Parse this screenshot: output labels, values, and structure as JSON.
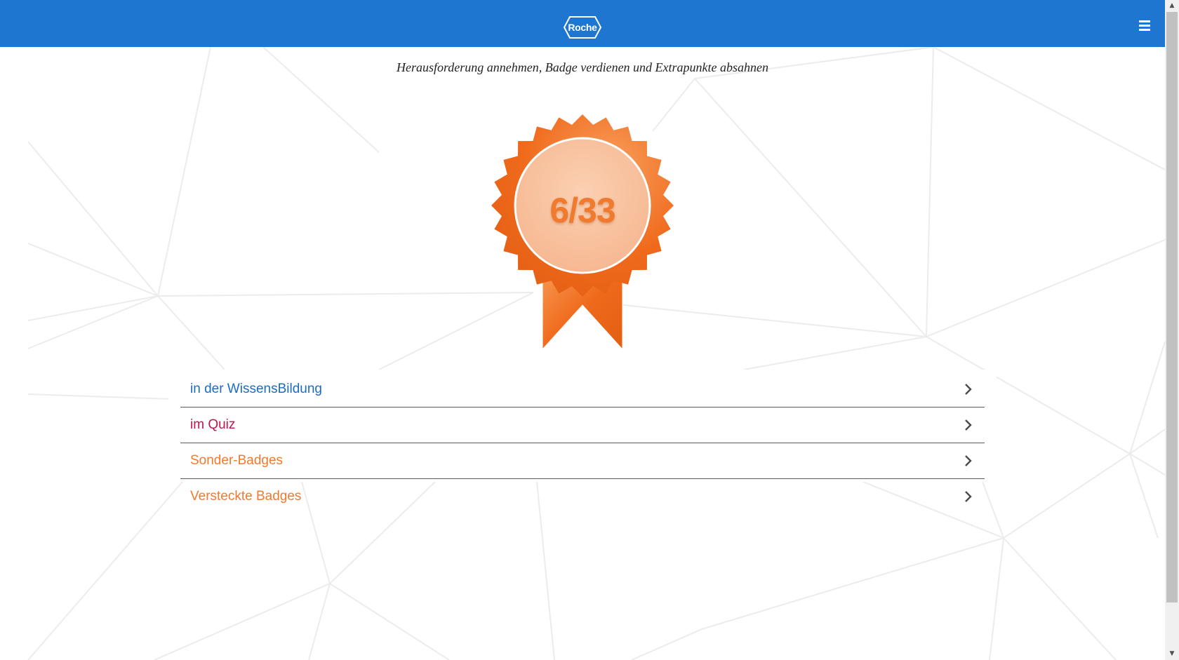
{
  "header": {
    "logo_text": "Roche",
    "menu_icon": "hamburger-icon",
    "background_color": "#1e76d0"
  },
  "subtitle": "Herausforderung annehmen, Badge verdienen und Extrapunkte absahnen",
  "badge": {
    "score": "6/33",
    "color": "#f07a2e"
  },
  "categories": [
    {
      "label": "in der WissensBildung",
      "color": "#1a6cc4",
      "icon": "chevron-right-icon"
    },
    {
      "label": "im Quiz",
      "color": "#c0154a",
      "icon": "chevron-right-icon"
    },
    {
      "label": "Sonder-Badges",
      "color": "#f07a2e",
      "icon": "chevron-right-icon"
    },
    {
      "label": "Versteckte Badges",
      "color": "#f07a2e",
      "icon": "chevron-right-icon"
    }
  ]
}
